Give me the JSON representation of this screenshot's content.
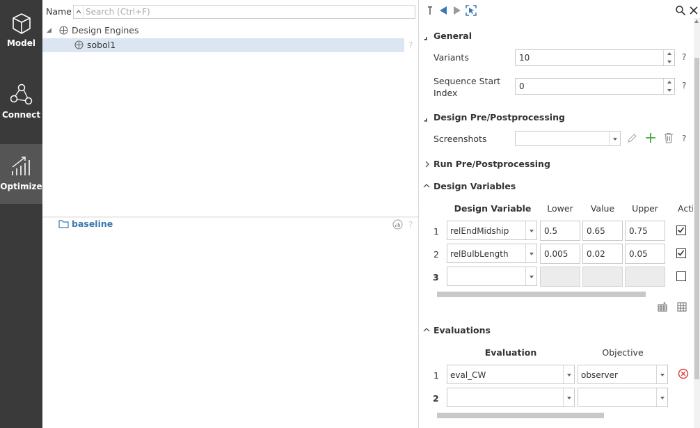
{
  "nav": {
    "model": "Model",
    "connect": "Connect",
    "optimize": "Optimize"
  },
  "tree": {
    "column_header": "Name",
    "search_placeholder": "Search (Ctrl+F)",
    "root_label": "Design Engines",
    "child_label": "sobol1",
    "help": "?"
  },
  "lower": {
    "folder_label": "baseline",
    "help": "?"
  },
  "props": {
    "general": {
      "title": "General",
      "variants_label": "Variants",
      "variants_value": "10",
      "seq_label_line1": "Sequence Start",
      "seq_label_line2": "Index",
      "seq_value": "0"
    },
    "design_pre": {
      "title": "Design Pre/Postprocessing",
      "screenshots_label": "Screenshots",
      "screenshots_value": ""
    },
    "run_pre": {
      "title": "Run Pre/Postprocessing"
    },
    "design_vars": {
      "title": "Design Variables",
      "headers": [
        "Design Variable",
        "Lower",
        "Value",
        "Upper",
        "Acti"
      ],
      "rows": [
        {
          "num": "1",
          "name": "relEndMidship",
          "lower": "0.5",
          "value": "0.65",
          "upper": "0.75",
          "active": true
        },
        {
          "num": "2",
          "name": "relBulbLength",
          "lower": "0.005",
          "value": "0.02",
          "upper": "0.05",
          "active": true
        },
        {
          "num": "3",
          "name": "",
          "lower": "",
          "value": "",
          "upper": "",
          "active": false
        }
      ]
    },
    "evaluations": {
      "title": "Evaluations",
      "headers": [
        "Evaluation",
        "Objective"
      ],
      "rows": [
        {
          "num": "1",
          "evaluation": "eval_CW",
          "objective": "observer"
        },
        {
          "num": "2",
          "evaluation": "",
          "objective": ""
        }
      ]
    },
    "help": "?"
  },
  "colors": {
    "sidebar": "#3a3a3a",
    "sidebar_active": "#555555",
    "selection": "#dce6f2",
    "link_blue": "#3a78b4",
    "add_green": "#3ea83e",
    "delete_red": "#d93a3a"
  }
}
